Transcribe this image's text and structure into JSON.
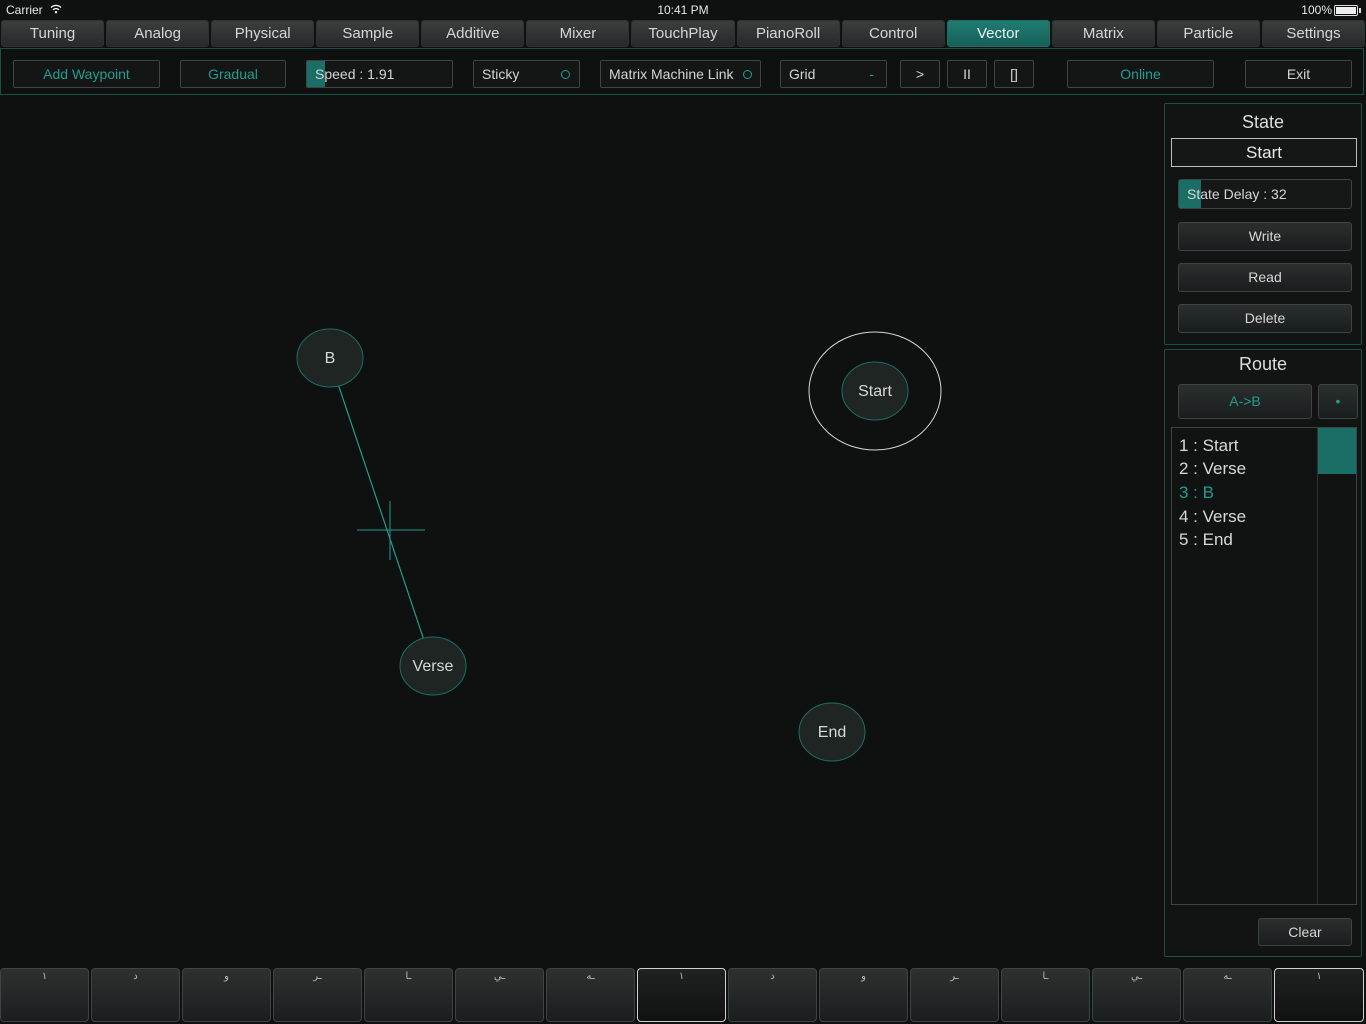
{
  "status": {
    "carrier": "Carrier",
    "time": "10:41 PM",
    "battery": "100%"
  },
  "tabs": [
    "Tuning",
    "Analog",
    "Physical",
    "Sample",
    "Additive",
    "Mixer",
    "TouchPlay",
    "PianoRoll",
    "Control",
    "Vector",
    "Matrix",
    "Particle",
    "Settings"
  ],
  "active_tab": "Vector",
  "toolbar": {
    "add_waypoint": "Add Waypoint",
    "gradual": "Gradual",
    "speed": "Speed : 1.91",
    "sticky": "Sticky",
    "matrix_link": "Matrix Machine Link",
    "grid": "Grid",
    "grid_value": "-",
    "play": ">",
    "pause": "II",
    "stop": "[]",
    "online": "Online",
    "exit": "Exit"
  },
  "nodes": {
    "b": "B",
    "start": "Start",
    "verse": "Verse",
    "end": "End"
  },
  "state_panel": {
    "title": "State",
    "name": "Start",
    "delay": "State Delay : 32",
    "write": "Write",
    "read": "Read",
    "delete": "Delete"
  },
  "route_panel": {
    "title": "Route",
    "route": "A->B",
    "dot": "•",
    "items": [
      "1 : Start",
      "2 : Verse",
      "3 : B",
      "4 : Verse",
      "5 : End"
    ],
    "active_index": 2,
    "clear": "Clear"
  },
  "keys": [
    "۱",
    "د",
    "و",
    "ـر",
    "ـا",
    "ـي",
    "ـه",
    "۱",
    "د",
    "و",
    "ـر",
    "ـا",
    "ـي",
    "ـه",
    "۱"
  ],
  "colors": {
    "accent": "#1f9e90",
    "accent_dark": "#1a6e66",
    "background": "#0f1010"
  }
}
